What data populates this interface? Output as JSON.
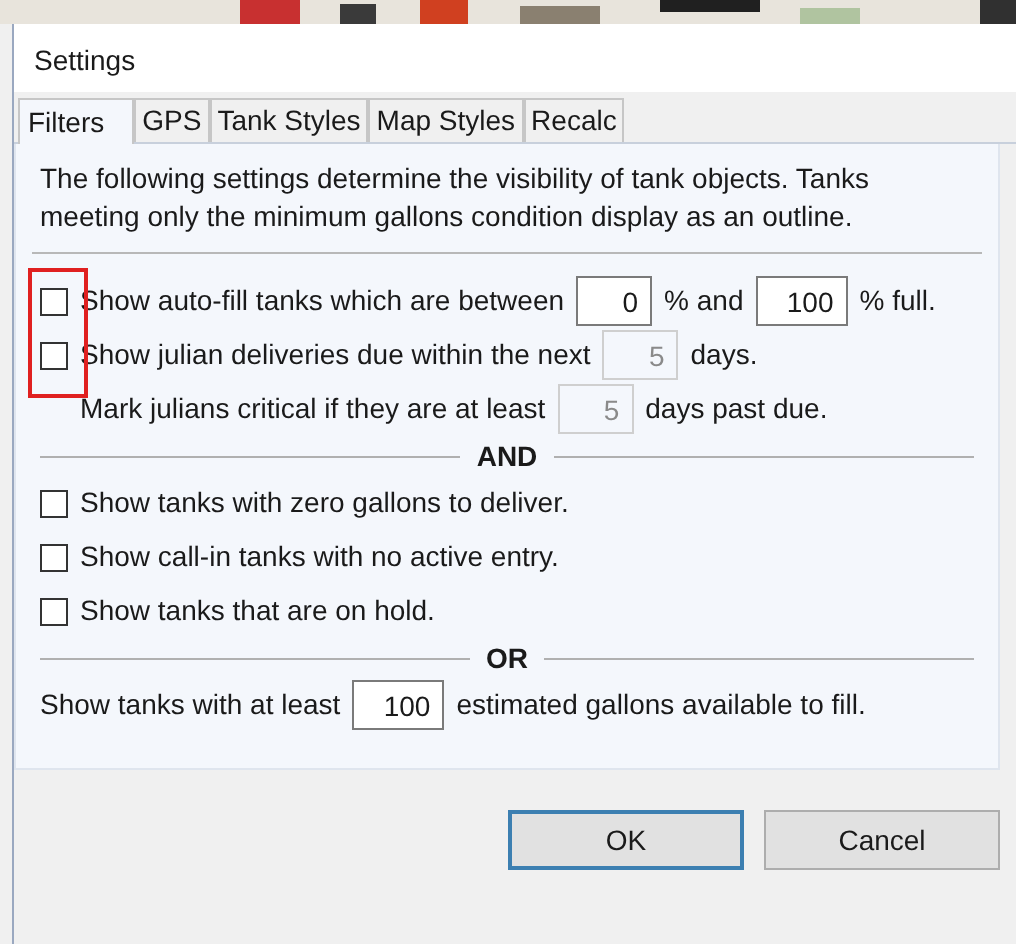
{
  "window": {
    "title": "Settings"
  },
  "tabs": [
    {
      "label": "Filters",
      "selected": true
    },
    {
      "label": "GPS",
      "selected": false
    },
    {
      "label": "Tank Styles",
      "selected": false
    },
    {
      "label": "Map Styles",
      "selected": false
    },
    {
      "label": "Recalc",
      "selected": false
    }
  ],
  "description": "The following settings determine the visibility of tank objects.  Tanks meeting only the minimum gallons condition display as an outline.",
  "rows": [
    {
      "kind": "checkbox",
      "checked": false,
      "highlighted": true,
      "parts": [
        {
          "kind": "label",
          "text": "Show auto-fill tanks which are between"
        },
        {
          "kind": "field",
          "value": "0",
          "disabled": false
        },
        {
          "kind": "label",
          "text": "% and"
        },
        {
          "kind": "field",
          "value": "100",
          "disabled": false
        },
        {
          "kind": "label",
          "text": "% full."
        }
      ]
    },
    {
      "kind": "checkbox",
      "checked": false,
      "highlighted": true,
      "parts": [
        {
          "kind": "label",
          "text": "Show julian deliveries due within the next"
        },
        {
          "kind": "field",
          "value": "5",
          "disabled": true
        },
        {
          "kind": "label",
          "text": "days."
        }
      ]
    },
    {
      "kind": "indented",
      "parts": [
        {
          "kind": "label",
          "text": "Mark julians critical if they are at least"
        },
        {
          "kind": "field",
          "value": "5",
          "disabled": true
        },
        {
          "kind": "label",
          "text": "days past due."
        }
      ]
    },
    {
      "kind": "divider",
      "text": "AND"
    },
    {
      "kind": "checkbox",
      "checked": false,
      "highlighted": false,
      "parts": [
        {
          "kind": "label",
          "text": "Show tanks with zero gallons to deliver."
        }
      ]
    },
    {
      "kind": "checkbox",
      "checked": false,
      "highlighted": false,
      "parts": [
        {
          "kind": "label",
          "text": "Show call-in tanks with no active entry."
        }
      ]
    },
    {
      "kind": "checkbox",
      "checked": false,
      "highlighted": false,
      "parts": [
        {
          "kind": "label",
          "text": "Show tanks that are on hold."
        }
      ]
    },
    {
      "kind": "divider",
      "text": "OR"
    },
    {
      "kind": "plain",
      "parts": [
        {
          "kind": "label",
          "text": "Show tanks with at least"
        },
        {
          "kind": "field",
          "value": "100",
          "disabled": false
        },
        {
          "kind": "label",
          "text": "estimated gallons available to fill."
        }
      ]
    }
  ],
  "buttons": [
    {
      "label": "OK",
      "default": true
    },
    {
      "label": "Cancel",
      "default": false
    }
  ]
}
